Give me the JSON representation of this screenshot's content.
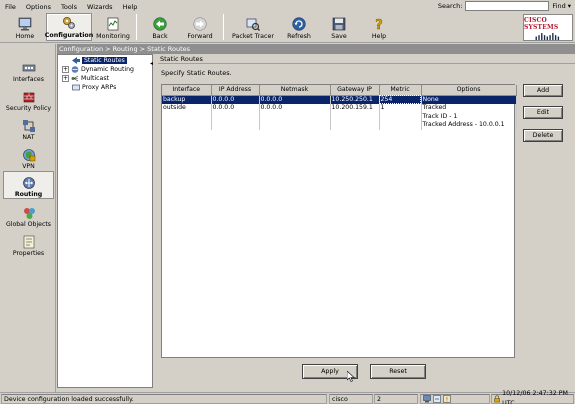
{
  "menu": [
    "File",
    "Options",
    "Tools",
    "Wizards",
    "Help"
  ],
  "search": {
    "label": "Search:",
    "value": "",
    "find_label": "Find"
  },
  "toolbar": {
    "home": "Home",
    "configuration": "Configuration",
    "monitoring": "Monitoring",
    "back": "Back",
    "forward": "Forward",
    "packet_tracer": "Packet Tracer",
    "refresh": "Refresh",
    "save": "Save",
    "help": "Help"
  },
  "brand": {
    "name": "Cisco Systems",
    "color": "#b0182d"
  },
  "nav": {
    "interfaces": "Interfaces",
    "security_policy": "Security Policy",
    "nat": "NAT",
    "vpn": "VPN",
    "routing": "Routing",
    "global_objects": "Global Objects",
    "properties": "Properties"
  },
  "breadcrumb": "Configuration > Routing > Static Routes",
  "tree": {
    "static_routes": "Static Routes",
    "dynamic_routing": "Dynamic Routing",
    "multicast": "Multicast",
    "proxy_arps": "Proxy ARPs"
  },
  "panel": {
    "title": "Static Routes",
    "description": "Specify Static Routes."
  },
  "table": {
    "columns": [
      "Interface",
      "IP Address",
      "Netmask",
      "Gateway IP",
      "Metric",
      "Options"
    ],
    "rows": [
      {
        "interface": "backup",
        "ip": "0.0.0.0",
        "netmask": "0.0.0.0",
        "gateway": "10.250.250.1",
        "metric": "254",
        "options": [
          "None"
        ]
      },
      {
        "interface": "outside",
        "ip": "0.0.0.0",
        "netmask": "0.0.0.0",
        "gateway": "10.200.159.1",
        "metric": "1",
        "options": [
          "Tracked",
          "Track ID - 1",
          "Tracked Address - 10.0.0.1"
        ]
      }
    ]
  },
  "buttons": {
    "add": "Add",
    "edit": "Edit",
    "delete": "Delete",
    "apply": "Apply",
    "reset": "Reset"
  },
  "status": {
    "message": "Device configuration loaded successfully.",
    "user": "cisco",
    "privilege": "2",
    "datetime": "10/12/06 2:47:32 PM UTC"
  },
  "colors": {
    "selection": "#0a246a",
    "breadcrumb_bg": "#8f8f8f",
    "chrome": "#d4d0c8"
  }
}
